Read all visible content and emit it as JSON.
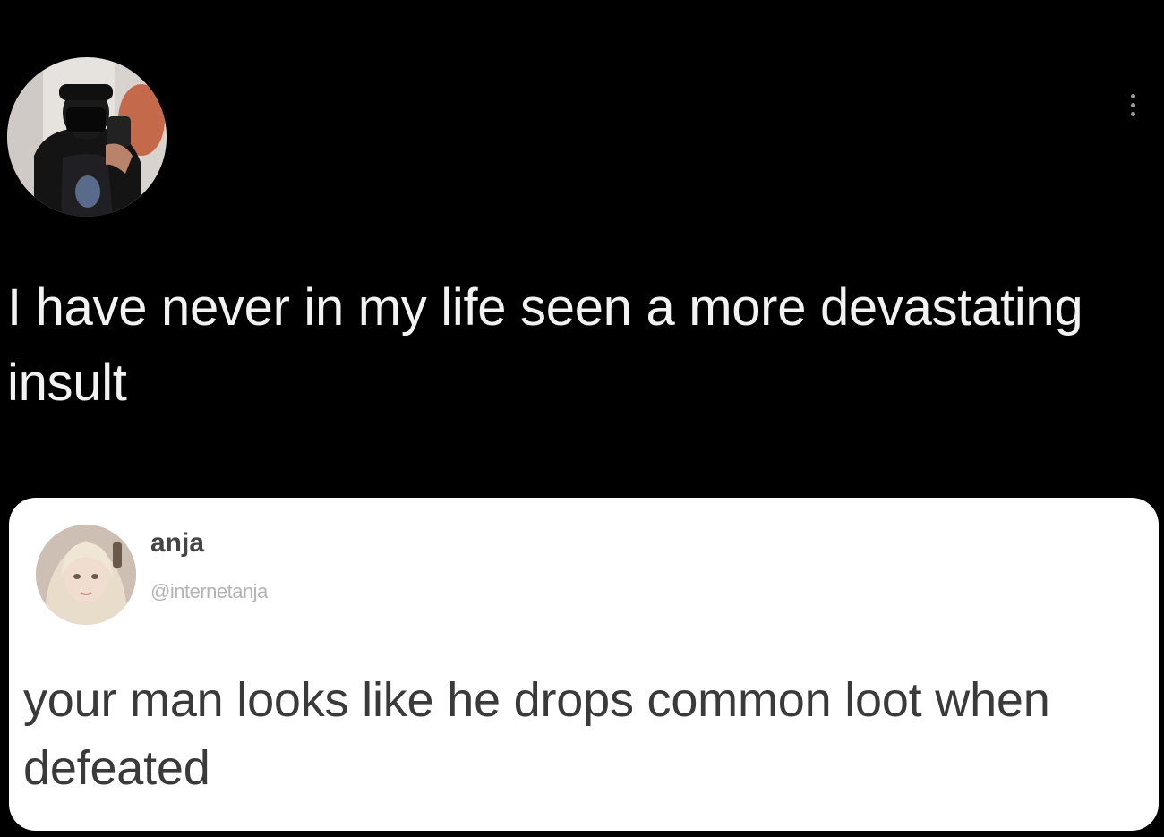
{
  "post": {
    "avatar_icon": "user-avatar-photo",
    "more_icon": "more-vertical-icon",
    "text": "I have never in my life seen a more devastating insult"
  },
  "quoted_post": {
    "avatar_icon": "user-avatar-photo",
    "name": "anja",
    "handle": "@internetanja",
    "text": "your man looks like he drops common loot when defeated"
  },
  "colors": {
    "background": "#000000",
    "post_text": "#f2f2f2",
    "card_background": "#ffffff",
    "card_text": "#3a3a3a",
    "handle_text": "#b4b4b4"
  }
}
